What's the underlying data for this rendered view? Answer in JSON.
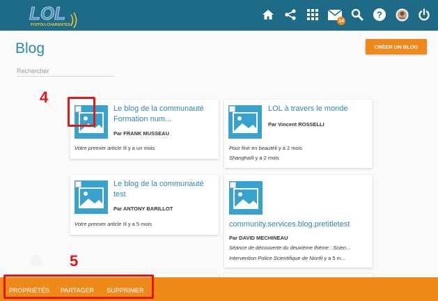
{
  "topbar": {
    "logo_text": "LOL",
    "logo_subtext": "POITOU-CHARENTES",
    "icons": [
      "home-icon",
      "share-icon",
      "apps-grid-icon",
      "mail-icon",
      "search-icon",
      "help-icon",
      "avatar",
      "power-icon"
    ],
    "mail_badge": "14"
  },
  "page": {
    "title": "Blog",
    "create_button": "CRÉER UN BLOG",
    "search_placeholder": "Rechercher"
  },
  "cards": [
    {
      "title": "Le blog de la communauté Formation num...",
      "author": "Par FRANK MUSSEAU",
      "lines": [
        {
          "italic": "Votre premier article !",
          "rest": "il y a un mois"
        }
      ]
    },
    {
      "title": "LOL à travers le monde",
      "author": "Par Vincent ROSSELLI",
      "lines": [
        {
          "italic": "Pour finir en beauté",
          "rest": "il y a 2 mois"
        },
        {
          "italic": "Shanghaï",
          "rest": "il y a 2 mois"
        }
      ]
    },
    {
      "title": "Le blog de la communauté test",
      "author": "Par ANTONY BARILLOT",
      "lines": [
        {
          "italic": "Votre premier article !",
          "rest": "il y a 5 mois"
        }
      ]
    },
    {
      "title": "community.services.blog.pretitletest",
      "author": "Par DAVID MECHINEAU",
      "lines": [
        {
          "italic": "Séance de découverte du deuxième thème : Scien...",
          "rest": ""
        },
        {
          "italic": "Intervention Police Scientifique de Niort",
          "rest": "il y a 5 m..."
        }
      ]
    }
  ],
  "annotations": {
    "label_4": "4",
    "label_5": "5"
  },
  "bottombar": {
    "properties": "PROPRIÉTÉS",
    "share": "PARTAGER",
    "delete": "SUPPRIMER"
  },
  "colors": {
    "topbar": "#1d6b86",
    "accent_orange": "#ef8a1a",
    "link_blue": "#2f86b0",
    "annotation_red": "#e11818"
  }
}
